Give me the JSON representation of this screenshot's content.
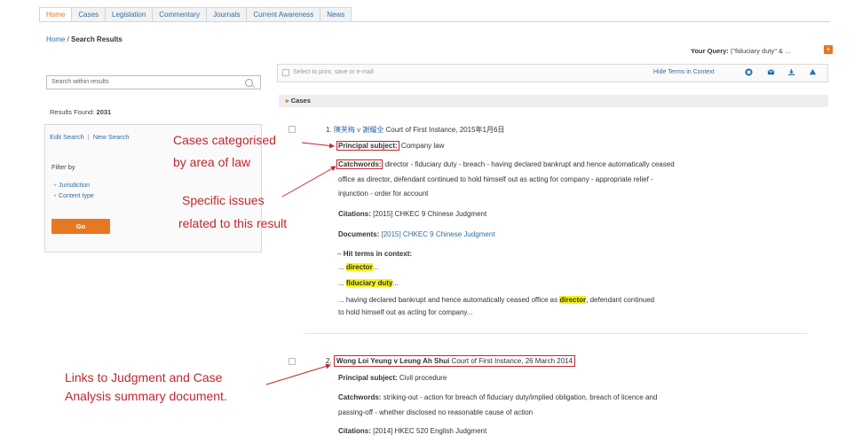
{
  "tabs": [
    "Home",
    "Cases",
    "Legislation",
    "Commentary",
    "Journals",
    "Current Awareness",
    "News"
  ],
  "breadcrumb": {
    "home": "Home",
    "sep": " / ",
    "current": "Search Results"
  },
  "query": {
    "label": "Your Query:",
    "value": "(\"fiduciary duty\" & ..."
  },
  "sidebar": {
    "search_placeholder": "Search within results",
    "results_found_label": "Results Found:",
    "results_found_count": "2031",
    "edit_search": "Edit Search",
    "link_sep": "|",
    "new_search": "New Search",
    "filter_by": "Filter by",
    "filters": [
      "Jurisdiction",
      "Content type"
    ],
    "go": "Go"
  },
  "toolbar": {
    "placeholder": "Select to print, save or e-mail",
    "hide_terms": "Hide Terms in Context"
  },
  "section_title": "Cases",
  "result1": {
    "number": "1.",
    "title": "陳芙梅 v 謝耀全",
    "court": "Court of First Instance, 2015年1月6日",
    "principal_label": "Principal subject:",
    "principal_value": "Company law",
    "catchwords_label": "Catchwords:",
    "catchwords_line1": "director - fiduciary duty - breach - having declared bankrupt and hence automatically ceased",
    "catchwords_line2": "office as director, defendant continued to hold himself out as acting for company - appropriate relief -",
    "catchwords_line3": "injunction - order for account",
    "citations_label": "Citations:",
    "citations_value": "[2015] CHKEC 9 Chinese Judgment",
    "documents_label": "Documents:",
    "documents_value": "[2015] CHKEC 9 Chinese Judgment",
    "hit_terms_label": "Hit terms in context:",
    "hit1": "director",
    "hit2": "fiduciary duty",
    "ctx_prefix": "... having declared bankrupt and hence automatically ceased office as",
    "ctx_hit": "director",
    "ctx_suffix": ", defendant continued",
    "ctx_line2": "to hold himself out as acting for company..."
  },
  "result2": {
    "number": "2.",
    "title": "Wong Loi Yeung v Leung Ah Shui",
    "court": "Court of First Instance, 26 March 2014",
    "principal_label": "Principal subject:",
    "principal_value": "Civil procedure",
    "catchwords_label": "Catchwords:",
    "catchwords_line1": "striking-out - action for breach of fiduciary duty/implied obligation, breach of licence and",
    "catchwords_line2": "passing-off - whether disclosed no reasonable cause of action",
    "citations_label": "Citations:",
    "citations_value": "[2014] HKEC 520 English Judgment"
  },
  "annotations": {
    "a1_line1": "Cases categorised",
    "a1_line2": "by area of law",
    "a2_line1": "Specific issues",
    "a2_line2": "related to this result",
    "a3_line1": "Links to Judgment and Case",
    "a3_line2": "Analysis summary document."
  },
  "colors": {
    "accent": "#e87722",
    "link": "#2f6ea5",
    "annotation": "#c2272d",
    "highlight": "#f5f219"
  },
  "icons": [
    "printer-icon",
    "email-icon",
    "download-icon",
    "upload-icon"
  ]
}
